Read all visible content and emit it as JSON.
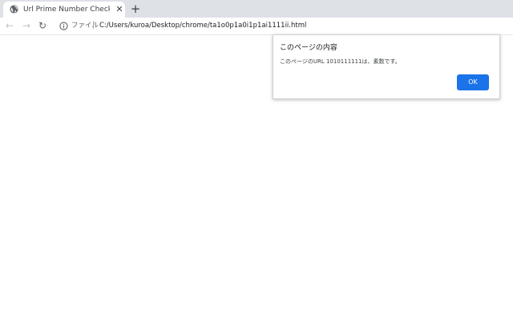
{
  "tab": {
    "title": "Url Prime Number Checker",
    "close_glyph": "✕",
    "favicon": "globe-icon"
  },
  "new_tab_glyph": "+",
  "toolbar": {
    "back_glyph": "←",
    "forward_glyph": "→",
    "reload_glyph": "↻",
    "info_icon": "info-icon",
    "file_label": "ファイル",
    "separator": "|",
    "url": "C:/Users/kuroa/Desktop/chrome/ta1o0p1a0i1p1ai1111ii.html"
  },
  "dialog": {
    "title": "このページの内容",
    "message": "このページのURL 1010111111は、素数です。",
    "ok_label": "OK"
  },
  "colors": {
    "accent": "#1a73e8",
    "tabstrip": "#dee1e6"
  }
}
